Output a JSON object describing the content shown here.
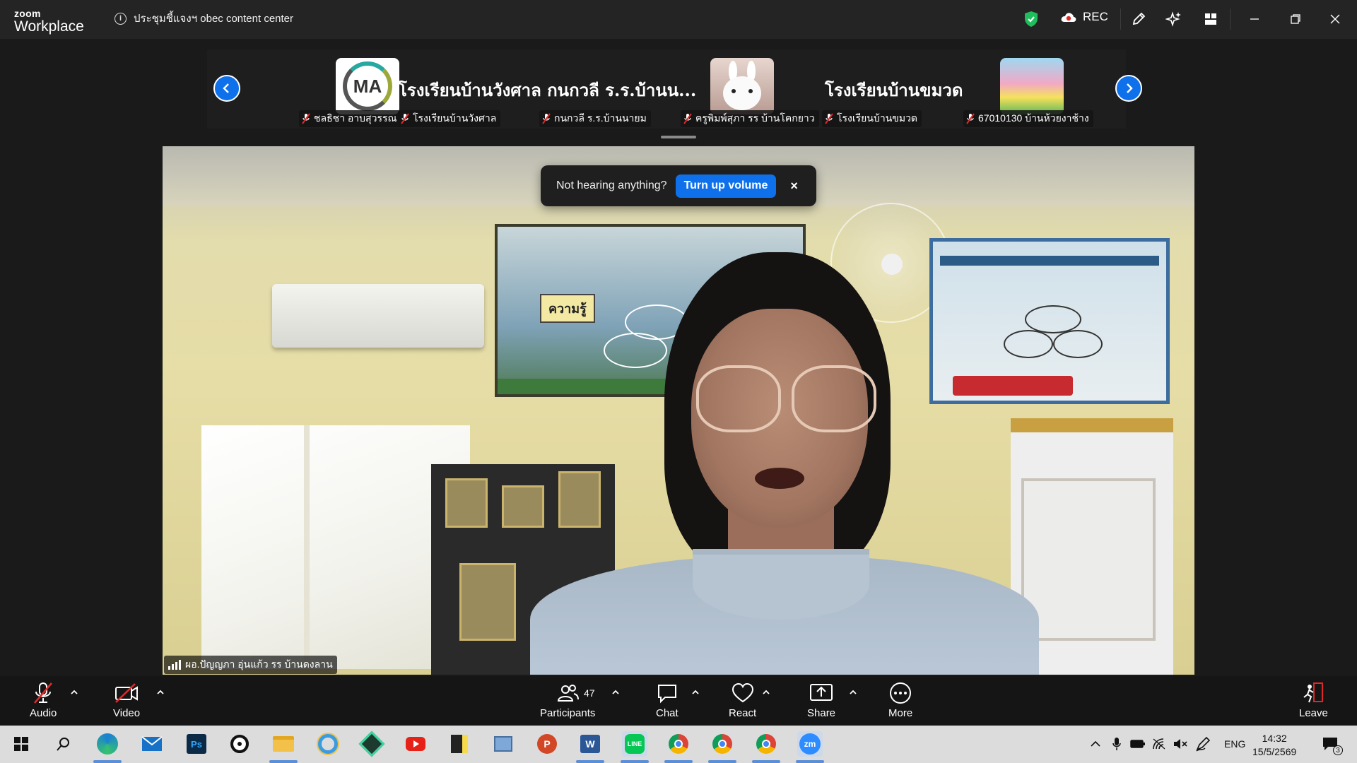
{
  "titlebar": {
    "brand_top": "zoom",
    "brand_bottom": "Workplace",
    "meeting_title": "ประชุมชี้แจงฯ obec content center",
    "rec_label": "REC"
  },
  "gallery": {
    "tiles": [
      {
        "name": "ชลธิชา อาบสุวรรณ",
        "avatar_text": "MA"
      },
      {
        "name": "โรงเรียนบ้านวังศาล",
        "display": "โรงเรียนบ้านวังศาล กนกวลี ร.ร.บ้านน..."
      },
      {
        "name": "กนกวลี ร.ร.บ้านนายม"
      },
      {
        "name": "ครูพิมพ์สุภา รร บ้านโคกยาว"
      },
      {
        "name": "โรงเรียนบ้านขมวด",
        "display": "โรงเรียนบ้านขมวด"
      },
      {
        "name": "67010130 บ้านห้วยงาช้าง"
      }
    ]
  },
  "toast": {
    "message": "Not hearing anything?",
    "button": "Turn up volume",
    "close": "×"
  },
  "main_video": {
    "speaker_name": "ผอ.ปัญญภา อุ่นแก้ว รร บ้านดงลาน",
    "poster_word": "ความรู้"
  },
  "toolbar": {
    "audio": "Audio",
    "video": "Video",
    "participants": "Participants",
    "participants_count": "47",
    "chat": "Chat",
    "react": "React",
    "share": "Share",
    "more": "More",
    "leave": "Leave"
  },
  "taskbar": {
    "lang": "ENG",
    "time": "14:32",
    "date": "15/5/2569",
    "notif_count": "3"
  },
  "colors": {
    "accent_blue": "#0e71eb",
    "mute_red": "#e02828",
    "shield_green": "#1fbd5b"
  }
}
